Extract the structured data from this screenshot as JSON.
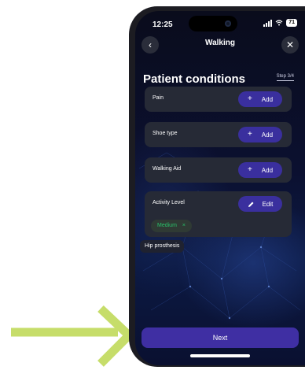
{
  "status": {
    "time": "12:25",
    "battery": "71"
  },
  "header": {
    "title": "Walking",
    "back_icon": "chevron-left-icon",
    "close_icon": "close-icon"
  },
  "page": {
    "title": "Patient conditions",
    "step": "Step 3/4"
  },
  "conditions": [
    {
      "label": "Pain",
      "action_symbol": "+",
      "action": "Add"
    },
    {
      "label": "Shoe type",
      "action_symbol": "+",
      "action": "Add"
    },
    {
      "label": "Walking Aid",
      "action_symbol": "+",
      "action": "Add"
    }
  ],
  "activity": {
    "label": "Activity Level",
    "action": "Edit",
    "selected": "Medium",
    "remove_symbol": "×"
  },
  "tooltip": "Hip prosthesis",
  "footer": {
    "next_label": "Next"
  },
  "colors": {
    "accent": "#3a2f9e",
    "card": "#262a36",
    "chip_text": "#29c06a",
    "arrow": "#c6dd6a"
  }
}
